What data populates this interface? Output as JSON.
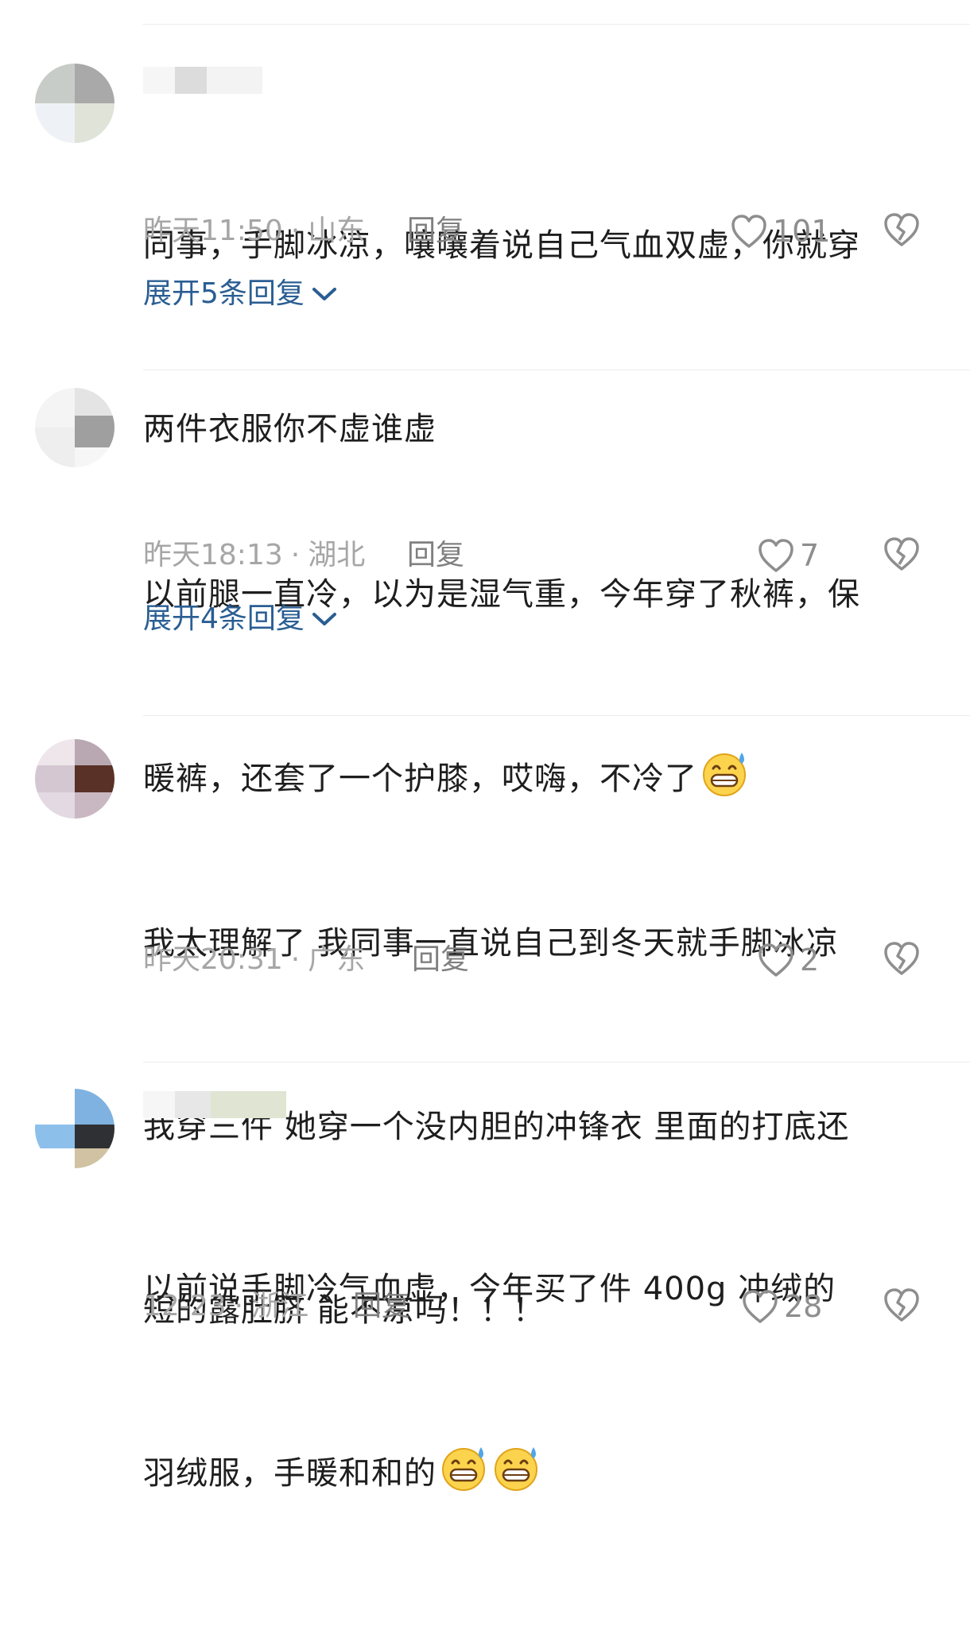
{
  "comments": [
    {
      "text_lines": [
        "同事，手脚冰凉，嚷嚷着说自己气血双虚，你就穿",
        "两件衣服你不虚谁虚"
      ],
      "time": "昨天11:50",
      "location": "山东",
      "reply_label": "回复",
      "likes": "101",
      "expand_label": "展开5条回复"
    },
    {
      "text_lines": [
        "以前腿一直冷，以为是湿气重，今年穿了秋裤，保",
        "暖裤，还套了一个护膝，哎嗨，不冷了"
      ],
      "time": "昨天18:13",
      "location": "湖北",
      "reply_label": "回复",
      "likes": "7",
      "expand_label": "展开4条回复"
    },
    {
      "text_lines": [
        "我太理解了 我同事一直说自己到冬天就手脚冰凉",
        "我穿三件 她穿一个没内胆的冲锋衣 里面的打底还",
        "短的露肚脐 能不凉吗！！！"
      ],
      "time": "昨天20:31",
      "location": "广东",
      "reply_label": "回复",
      "likes": "2"
    },
    {
      "text_lines": [
        "以前说手脚冷气血虚，今年买了件 400g 冲绒的",
        "羽绒服，手暖和和的"
      ],
      "time": "12-23",
      "location": "浙江",
      "reply_label": "回复",
      "likes": "28"
    }
  ],
  "meta_separator": "·",
  "icons": {
    "like": "heart-outline-icon",
    "dislike": "broken-heart-icon",
    "expand": "chevron-down-icon",
    "emoji": "grinning-sweat-emoji"
  },
  "colors": {
    "expand_link": "#2a5e93",
    "meta_text": "#a6a6a6",
    "body_text": "#1e1e1e"
  }
}
